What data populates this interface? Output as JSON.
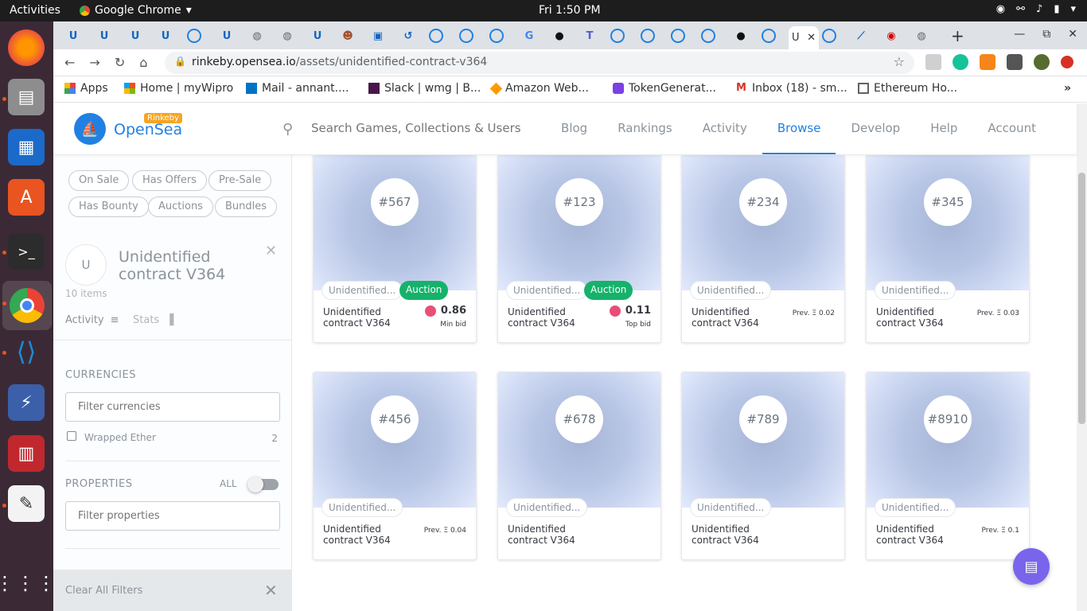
{
  "system": {
    "activities": "Activities",
    "app_name": "Google Chrome",
    "clock": "Fri  1:50 PM"
  },
  "browser": {
    "url_host": "rinkeby.opensea.io",
    "url_path": "/assets/unidentified-contract-v364",
    "active_tab_label": "U",
    "bookmarks": [
      {
        "label": "Apps",
        "color": "#ea4335"
      },
      {
        "label": "Home | myWipro",
        "color": "#f25022"
      },
      {
        "label": "Mail - annant....",
        "color": "#0072c6"
      },
      {
        "label": "Slack | wmg | B...",
        "color": "#4a154b"
      },
      {
        "label": "Amazon Web...",
        "color": "#ff9900"
      },
      {
        "label": "TokenGenerat...",
        "color": "#7b3fe4"
      },
      {
        "label": "Inbox (18) - sm...",
        "color": "#d93025"
      },
      {
        "label": "Ethereum Ho...",
        "color": "#5f6368"
      }
    ]
  },
  "header": {
    "brand": "OpenSea",
    "network_badge": "Rinkeby",
    "search_placeholder": "Search Games, Collections & Users",
    "nav": [
      "Blog",
      "Rankings",
      "Activity",
      "Browse",
      "Develop",
      "Help",
      "Account"
    ],
    "active_nav": "Browse"
  },
  "sidebar": {
    "status_filters": [
      "On Sale",
      "Has Offers",
      "Pre-Sale",
      "Has Bounty",
      "Auctions",
      "Bundles"
    ],
    "collection": {
      "avatar_letter": "U",
      "name": "Unidentified contract V364",
      "items_count": "10 items",
      "activity_label": "Activity",
      "stats_label": "Stats"
    },
    "currencies_title": "CURRENCIES",
    "currencies_placeholder": "Filter currencies",
    "currencies": [
      {
        "name": "Wrapped Ether",
        "count": "2"
      }
    ],
    "properties_title": "PROPERTIES",
    "properties_all": "ALL",
    "properties_placeholder": "Filter properties",
    "clear_all": "Clear All Filters"
  },
  "cards": [
    {
      "token": "#567",
      "collection": "Unidentified...",
      "badge": "Auction",
      "name": "Unidentified contract V364",
      "price": "0.86",
      "price_label": "Min bid",
      "prev": ""
    },
    {
      "token": "#123",
      "collection": "Unidentified...",
      "badge": "Auction",
      "name": "Unidentified contract V364",
      "price": "0.11",
      "price_label": "Top bid",
      "prev": ""
    },
    {
      "token": "#234",
      "collection": "Unidentified...",
      "badge": "",
      "name": "Unidentified contract V364",
      "price": "",
      "price_label": "",
      "prev": "Prev. Ξ 0.02"
    },
    {
      "token": "#345",
      "collection": "Unidentified...",
      "badge": "",
      "name": "Unidentified contract V364",
      "price": "",
      "price_label": "",
      "prev": "Prev. Ξ 0.03"
    },
    {
      "token": "#456",
      "collection": "Unidentified...",
      "badge": "",
      "name": "Unidentified contract V364",
      "price": "",
      "price_label": "",
      "prev": "Prev. Ξ 0.04"
    },
    {
      "token": "#678",
      "collection": "Unidentified...",
      "badge": "",
      "name": "Unidentified contract V364",
      "price": "",
      "price_label": "",
      "prev": ""
    },
    {
      "token": "#789",
      "collection": "Unidentified...",
      "badge": "",
      "name": "Unidentified contract V364",
      "price": "",
      "price_label": "",
      "prev": ""
    },
    {
      "token": "#8910",
      "collection": "Unidentified...",
      "badge": "",
      "name": "Unidentified contract V364",
      "price": "",
      "price_label": "",
      "prev": "Prev. Ξ 0.1"
    }
  ],
  "colors": {
    "accent": "#2081e2",
    "auction": "#15b26b",
    "chat": "#7965ec"
  }
}
